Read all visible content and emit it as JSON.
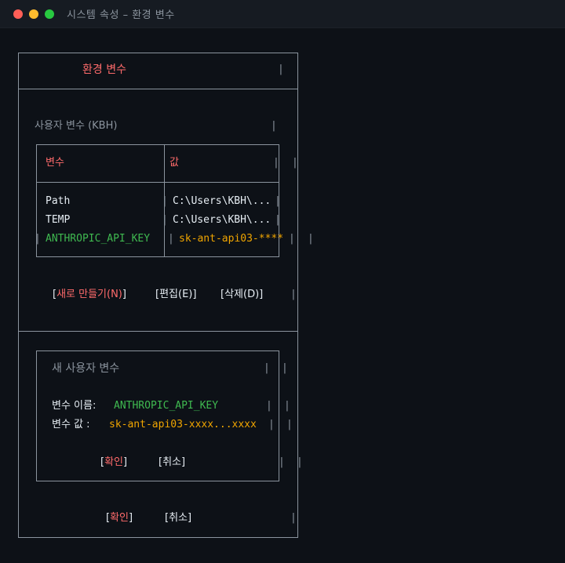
{
  "window": {
    "title": "시스템 속성 – 환경 변수"
  },
  "main": {
    "heading": "환경 변수",
    "user_section_label": "사용자 변수 (KBH)",
    "table": {
      "headers": [
        "변수",
        "값"
      ],
      "rows": [
        {
          "name": "Path",
          "value": "C:\\Users\\KBH\\..."
        },
        {
          "name": "TEMP",
          "value": "C:\\Users\\KBH\\..."
        },
        {
          "name": "ANTHROPIC_API_KEY",
          "value": "sk-ant-api03-****"
        }
      ]
    },
    "buttons": {
      "new_bracket_open": "[",
      "new_label": "새로 만들기(N)",
      "new_bracket_close": "]",
      "edit": "[편집(E)]",
      "delete": "[삭제(D)]"
    }
  },
  "dialog": {
    "title": "새 사용자 변수",
    "name_label": "변수 이름:",
    "name_value": "ANTHROPIC_API_KEY",
    "value_label": "변수 값 :",
    "value_value": "sk-ant-api03-xxxx...xxxx",
    "ok_open": "[",
    "ok_label": "확인",
    "ok_close": "]",
    "cancel": "[취소]"
  },
  "footer": {
    "ok_open": "[",
    "ok_label": "확인",
    "ok_close": "]",
    "cancel": "[취소]"
  },
  "colors": {
    "background": "#0d1117",
    "border": "#8b949e",
    "accent_red": "#ff6b6b",
    "accent_green": "#3fb950",
    "accent_orange": "#f0a500"
  }
}
